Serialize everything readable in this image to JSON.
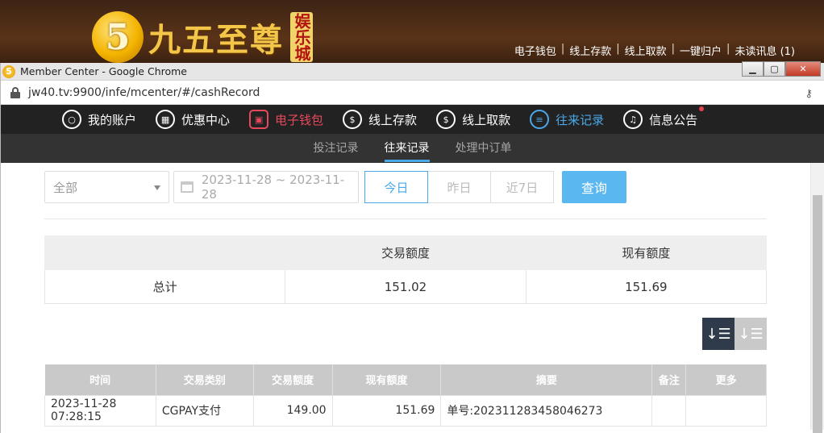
{
  "site": {
    "logo_digit": "5",
    "logo_name": "九五至尊",
    "logo_tag": "娱乐城",
    "links": [
      "电子钱包",
      "线上存款",
      "线上取款",
      "一键归户",
      "未读讯息 (1)"
    ]
  },
  "window": {
    "title": "Member Center - Google Chrome",
    "url": "jw40.tv:9900/infe/mcenter/#/cashRecord",
    "controls": {
      "minimize": "▁",
      "maximize": "▢",
      "close": "✕"
    }
  },
  "nav": {
    "items": [
      {
        "label": "我的账户",
        "icon": "user-icon",
        "glyph": "○"
      },
      {
        "label": "优惠中心",
        "icon": "gift-icon",
        "glyph": "▦"
      },
      {
        "label": "电子钱包",
        "icon": "wallet-icon",
        "glyph": "▣",
        "active": true,
        "color": "#e8485c"
      },
      {
        "label": "线上存款",
        "icon": "deposit-icon",
        "glyph": "$"
      },
      {
        "label": "线上取款",
        "icon": "withdraw-icon",
        "glyph": "$"
      },
      {
        "label": "往来记录",
        "icon": "record-icon",
        "glyph": "≡",
        "color": "#4aa8e8"
      },
      {
        "label": "信息公告",
        "icon": "bell-icon",
        "glyph": "♫"
      }
    ],
    "sub_items": [
      {
        "label": "投注记录",
        "active": false
      },
      {
        "label": "往来记录",
        "active": true
      },
      {
        "label": "处理中订单",
        "active": false
      }
    ]
  },
  "filter": {
    "type_value": "全部",
    "date_range": "2023-11-28 ~ 2023-11-28",
    "range_buttons": [
      {
        "label": "今日",
        "active": true
      },
      {
        "label": "昨日",
        "active": false
      },
      {
        "label": "近7日",
        "active": false
      }
    ],
    "query_label": "查询"
  },
  "summary": {
    "headers": [
      "",
      "交易额度",
      "现有额度"
    ],
    "row_label": "总计",
    "transaction_total": "151.02",
    "current_balance": "151.69"
  },
  "sort": {
    "desc_icon": "sort-desc-icon",
    "asc_icon": "sort-asc-icon"
  },
  "records": {
    "headers": [
      "时间",
      "交易类别",
      "交易额度",
      "现有额度",
      "摘要",
      "备注",
      "更多"
    ],
    "rows": [
      [
        "2023-11-28 07:28:15",
        "CGPAY支付",
        "149.00",
        "151.69",
        "单号:202311283458046273",
        "",
        ""
      ]
    ]
  },
  "colors": {
    "accent_blue": "#4aa8e8",
    "accent_red": "#e8485c",
    "nav_dark": "#222222",
    "query_button": "#5bb7ef"
  }
}
